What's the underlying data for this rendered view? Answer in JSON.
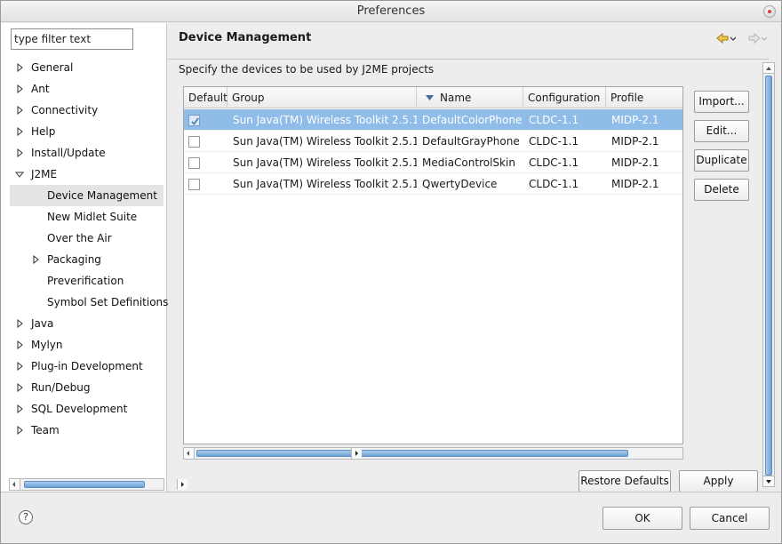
{
  "window": {
    "title": "Preferences"
  },
  "filter": {
    "value": "type filter text"
  },
  "tree": [
    {
      "label": "General",
      "expandable": true,
      "expanded": false,
      "level": 0
    },
    {
      "label": "Ant",
      "expandable": true,
      "expanded": false,
      "level": 0
    },
    {
      "label": "Connectivity",
      "expandable": true,
      "expanded": false,
      "level": 0
    },
    {
      "label": "Help",
      "expandable": true,
      "expanded": false,
      "level": 0
    },
    {
      "label": "Install/Update",
      "expandable": true,
      "expanded": false,
      "level": 0
    },
    {
      "label": "J2ME",
      "expandable": true,
      "expanded": true,
      "level": 0
    },
    {
      "label": "Device Management",
      "expandable": false,
      "level": 1,
      "selected": true
    },
    {
      "label": "New Midlet Suite",
      "expandable": false,
      "level": 1
    },
    {
      "label": "Over the Air",
      "expandable": false,
      "level": 1
    },
    {
      "label": "Packaging",
      "expandable": true,
      "expanded": false,
      "level": 1
    },
    {
      "label": "Preverification",
      "expandable": false,
      "level": 1
    },
    {
      "label": "Symbol Set Definitions",
      "expandable": false,
      "level": 1
    },
    {
      "label": "Java",
      "expandable": true,
      "expanded": false,
      "level": 0
    },
    {
      "label": "Mylyn",
      "expandable": true,
      "expanded": false,
      "level": 0
    },
    {
      "label": "Plug-in Development",
      "expandable": true,
      "expanded": false,
      "level": 0
    },
    {
      "label": "Run/Debug",
      "expandable": true,
      "expanded": false,
      "level": 0
    },
    {
      "label": "SQL Development",
      "expandable": true,
      "expanded": false,
      "level": 0
    },
    {
      "label": "Team",
      "expandable": true,
      "expanded": false,
      "level": 0
    }
  ],
  "page": {
    "title": "Device Management",
    "description": "Specify the devices to be used by J2ME projects",
    "back_icon": "back-arrow-icon",
    "forward_icon": "forward-arrow-icon"
  },
  "table": {
    "columns": [
      "Default",
      "Group",
      "Name",
      "Configuration",
      "Profile"
    ],
    "sort_column": "Name",
    "rows": [
      {
        "default": true,
        "group": "Sun Java(TM) Wireless Toolkit 2.5.1",
        "name": "DefaultColorPhone",
        "configuration": "CLDC-1.1",
        "profile": "MIDP-2.1",
        "selected": true
      },
      {
        "default": false,
        "group": "Sun Java(TM) Wireless Toolkit 2.5.1",
        "name": "DefaultGrayPhone",
        "configuration": "CLDC-1.1",
        "profile": "MIDP-2.1"
      },
      {
        "default": false,
        "group": "Sun Java(TM) Wireless Toolkit 2.5.1",
        "name": "MediaControlSkin",
        "configuration": "CLDC-1.1",
        "profile": "MIDP-2.1"
      },
      {
        "default": false,
        "group": "Sun Java(TM) Wireless Toolkit 2.5.1",
        "name": "QwertyDevice",
        "configuration": "CLDC-1.1",
        "profile": "MIDP-2.1"
      }
    ]
  },
  "buttons": {
    "import": "Import...",
    "edit": "Edit...",
    "duplicate": "Duplicate",
    "delete": "Delete",
    "restore_defaults": "Restore Defaults",
    "apply": "Apply",
    "ok": "OK",
    "cancel": "Cancel"
  },
  "help": {
    "glyph": "?"
  },
  "colors": {
    "selection": "#8fbce8",
    "scroll_thumb": "#6fa3d6"
  }
}
